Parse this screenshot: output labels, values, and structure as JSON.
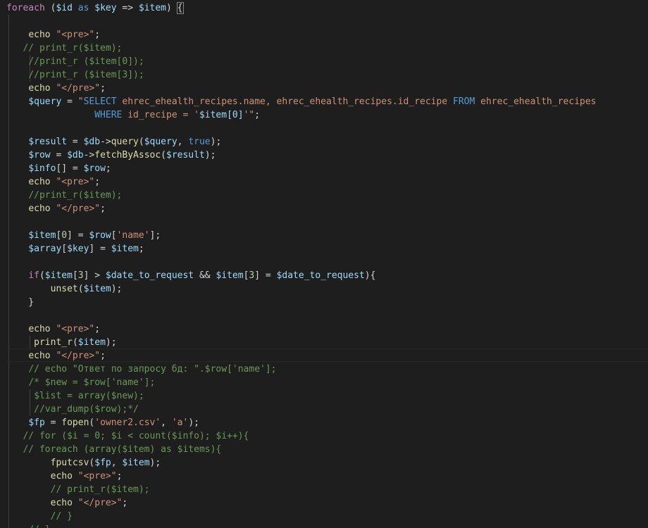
{
  "theme": {
    "background": "#1e1e1e",
    "keyword": "#569cd6",
    "control": "#c586c0",
    "variable": "#9cdcfe",
    "function": "#dcdcaa",
    "string": "#ce9178",
    "number": "#b5cea8",
    "comment": "#6a9955",
    "text": "#d4d4d4"
  },
  "code_lines": [
    {
      "tokens": [
        [
          "ctl",
          "foreach"
        ],
        [
          "op",
          " ("
        ],
        [
          "var",
          "$id"
        ],
        [
          "kw",
          " as "
        ],
        [
          "var",
          "$key"
        ],
        [
          "op",
          " => "
        ],
        [
          "var",
          "$item"
        ],
        [
          "op",
          ") "
        ],
        [
          "brace",
          "{"
        ]
      ]
    },
    {
      "tokens": []
    },
    {
      "tokens": [
        [
          "op",
          "    "
        ],
        [
          "fn",
          "echo"
        ],
        [
          "op",
          " "
        ],
        [
          "str",
          "\"<pre>\""
        ],
        [
          "op",
          ";"
        ]
      ]
    },
    {
      "tokens": [
        [
          "op",
          "   "
        ],
        [
          "cmt",
          "// print_r($item);"
        ]
      ]
    },
    {
      "tokens": [
        [
          "op",
          "    "
        ],
        [
          "cmt",
          "//print_r ($item[0]);"
        ]
      ]
    },
    {
      "tokens": [
        [
          "op",
          "    "
        ],
        [
          "cmt",
          "//print_r ($item[3]);"
        ]
      ]
    },
    {
      "tokens": [
        [
          "op",
          "    "
        ],
        [
          "fn",
          "echo"
        ],
        [
          "op",
          " "
        ],
        [
          "str",
          "\"</pre>\""
        ],
        [
          "op",
          ";"
        ]
      ]
    },
    {
      "tokens": [
        [
          "op",
          "    "
        ],
        [
          "var",
          "$query"
        ],
        [
          "op",
          " = "
        ],
        [
          "str",
          "\""
        ],
        [
          "sqlkw",
          "SELECT"
        ],
        [
          "str",
          " ehrec_ehealth_recipes.name, ehrec_ehealth_recipes.id_recipe "
        ],
        [
          "sqlkw",
          "FROM"
        ],
        [
          "str",
          " ehrec_ehealth_recipes"
        ]
      ]
    },
    {
      "tokens": [
        [
          "op",
          "                "
        ],
        [
          "sqlkw",
          "WHERE"
        ],
        [
          "str",
          " id_recipe = '"
        ],
        [
          "var",
          "$item[0]"
        ],
        [
          "str",
          "'\""
        ],
        [
          "op",
          ";"
        ]
      ]
    },
    {
      "tokens": []
    },
    {
      "tokens": [
        [
          "op",
          "    "
        ],
        [
          "var",
          "$result"
        ],
        [
          "op",
          " = "
        ],
        [
          "var",
          "$db"
        ],
        [
          "op",
          "->"
        ],
        [
          "fn",
          "query"
        ],
        [
          "op",
          "("
        ],
        [
          "var",
          "$query"
        ],
        [
          "op",
          ", "
        ],
        [
          "kw",
          "true"
        ],
        [
          "op",
          ");"
        ]
      ]
    },
    {
      "tokens": [
        [
          "op",
          "    "
        ],
        [
          "var",
          "$row"
        ],
        [
          "op",
          " = "
        ],
        [
          "var",
          "$db"
        ],
        [
          "op",
          "->"
        ],
        [
          "fn",
          "fetchByAssoc"
        ],
        [
          "op",
          "("
        ],
        [
          "var",
          "$result"
        ],
        [
          "op",
          ");"
        ]
      ]
    },
    {
      "tokens": [
        [
          "op",
          "    "
        ],
        [
          "var",
          "$info"
        ],
        [
          "op",
          "[] = "
        ],
        [
          "var",
          "$row"
        ],
        [
          "op",
          ";"
        ]
      ]
    },
    {
      "tokens": [
        [
          "op",
          "    "
        ],
        [
          "fn",
          "echo"
        ],
        [
          "op",
          " "
        ],
        [
          "str",
          "\"<pre>\""
        ],
        [
          "op",
          ";"
        ]
      ]
    },
    {
      "tokens": [
        [
          "op",
          "    "
        ],
        [
          "cmt",
          "//print_r($item);"
        ]
      ]
    },
    {
      "tokens": [
        [
          "op",
          "    "
        ],
        [
          "fn",
          "echo"
        ],
        [
          "op",
          " "
        ],
        [
          "str",
          "\"</pre>\""
        ],
        [
          "op",
          ";"
        ]
      ]
    },
    {
      "tokens": []
    },
    {
      "tokens": [
        [
          "op",
          "    "
        ],
        [
          "var",
          "$item"
        ],
        [
          "op",
          "["
        ],
        [
          "num",
          "0"
        ],
        [
          "op",
          "] = "
        ],
        [
          "var",
          "$row"
        ],
        [
          "op",
          "["
        ],
        [
          "str",
          "'name'"
        ],
        [
          "op",
          "];"
        ]
      ]
    },
    {
      "tokens": [
        [
          "op",
          "    "
        ],
        [
          "var",
          "$array"
        ],
        [
          "op",
          "["
        ],
        [
          "var",
          "$key"
        ],
        [
          "op",
          "] = "
        ],
        [
          "var",
          "$item"
        ],
        [
          "op",
          ";"
        ]
      ]
    },
    {
      "tokens": []
    },
    {
      "tokens": [
        [
          "op",
          "    "
        ],
        [
          "ctl",
          "if"
        ],
        [
          "op",
          "("
        ],
        [
          "var",
          "$item"
        ],
        [
          "op",
          "["
        ],
        [
          "num",
          "3"
        ],
        [
          "op",
          "] > "
        ],
        [
          "var",
          "$date_to_request"
        ],
        [
          "op",
          " && "
        ],
        [
          "var",
          "$item"
        ],
        [
          "op",
          "["
        ],
        [
          "num",
          "3"
        ],
        [
          "op",
          "] = "
        ],
        [
          "var",
          "$date_to_request"
        ],
        [
          "op",
          "){"
        ]
      ]
    },
    {
      "tokens": [
        [
          "op",
          "        "
        ],
        [
          "fn",
          "unset"
        ],
        [
          "op",
          "("
        ],
        [
          "var",
          "$item"
        ],
        [
          "op",
          ");"
        ]
      ]
    },
    {
      "tokens": [
        [
          "op",
          "    }"
        ]
      ]
    },
    {
      "tokens": []
    },
    {
      "tokens": [
        [
          "op",
          "    "
        ],
        [
          "fn",
          "echo"
        ],
        [
          "op",
          " "
        ],
        [
          "str",
          "\"<pre>\""
        ],
        [
          "op",
          ";"
        ]
      ]
    },
    {
      "tokens": [
        [
          "op",
          "     "
        ],
        [
          "fn",
          "print_r"
        ],
        [
          "op",
          "("
        ],
        [
          "var",
          "$item"
        ],
        [
          "op",
          ");"
        ]
      ]
    },
    {
      "tokens": [
        [
          "op",
          "    "
        ],
        [
          "fn",
          "echo"
        ],
        [
          "op",
          " "
        ],
        [
          "str",
          "\"</pre>\""
        ],
        [
          "op",
          ";"
        ]
      ]
    },
    {
      "tokens": [
        [
          "op",
          "    "
        ],
        [
          "cmt",
          "// echo \"Ответ по запросу бд: \".$row['name'];"
        ]
      ]
    },
    {
      "tokens": [
        [
          "op",
          "    "
        ],
        [
          "cmt",
          "/* $new = $row['name'];"
        ]
      ]
    },
    {
      "tokens": [
        [
          "op",
          "     "
        ],
        [
          "cmt",
          "$list = array($new);"
        ]
      ]
    },
    {
      "tokens": [
        [
          "op",
          "     "
        ],
        [
          "cmt",
          "//var_dump($row);*/"
        ]
      ]
    },
    {
      "tokens": [
        [
          "op",
          "    "
        ],
        [
          "var",
          "$fp"
        ],
        [
          "op",
          " = "
        ],
        [
          "fn",
          "fopen"
        ],
        [
          "op",
          "("
        ],
        [
          "str",
          "'owner2.csv'"
        ],
        [
          "op",
          ", "
        ],
        [
          "str",
          "'a'"
        ],
        [
          "op",
          ");"
        ]
      ]
    },
    {
      "tokens": [
        [
          "op",
          "   "
        ],
        [
          "cmt",
          "// for ($i = 0; $i < count($info); $i++){"
        ]
      ]
    },
    {
      "tokens": [
        [
          "op",
          "   "
        ],
        [
          "cmt",
          "// foreach (array($item) as $items){"
        ]
      ]
    },
    {
      "tokens": [
        [
          "op",
          "        "
        ],
        [
          "fn",
          "fputcsv"
        ],
        [
          "op",
          "("
        ],
        [
          "var",
          "$fp"
        ],
        [
          "op",
          ", "
        ],
        [
          "var",
          "$item"
        ],
        [
          "op",
          ");"
        ]
      ]
    },
    {
      "tokens": [
        [
          "op",
          "        "
        ],
        [
          "fn",
          "echo"
        ],
        [
          "op",
          " "
        ],
        [
          "str",
          "\"<pre>\""
        ],
        [
          "op",
          ";"
        ]
      ]
    },
    {
      "tokens": [
        [
          "op",
          "        "
        ],
        [
          "cmt",
          "// print_r($item);"
        ]
      ]
    },
    {
      "tokens": [
        [
          "op",
          "        "
        ],
        [
          "fn",
          "echo"
        ],
        [
          "op",
          " "
        ],
        [
          "str",
          "\"</pre>\""
        ],
        [
          "op",
          ";"
        ]
      ]
    },
    {
      "tokens": [
        [
          "op",
          "        "
        ],
        [
          "cmt",
          "// }"
        ]
      ]
    },
    {
      "tokens": [
        [
          "op",
          "    "
        ],
        [
          "cmt",
          "// }"
        ]
      ]
    }
  ]
}
